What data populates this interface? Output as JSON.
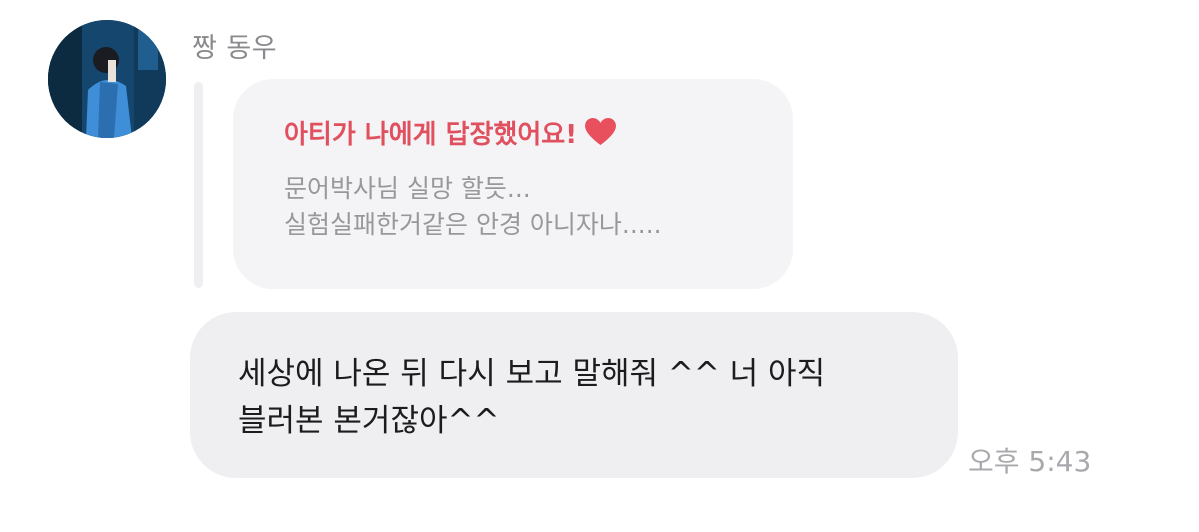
{
  "sender": {
    "name": "짱 동우"
  },
  "reply": {
    "header": "아티가 나에게 답장했어요!",
    "icon": "heart-icon",
    "accent_color": "#e0505f",
    "lines": [
      "문어박사님 실망 할듯...",
      "실험실패한거같은 안경 아니자나....."
    ]
  },
  "message": {
    "lines": [
      "세상에 나온 뒤 다시 보고 말해줘 ^^ 너 아직",
      "블러본 본거잖아^^"
    ]
  },
  "timestamp": "오후 5:43"
}
